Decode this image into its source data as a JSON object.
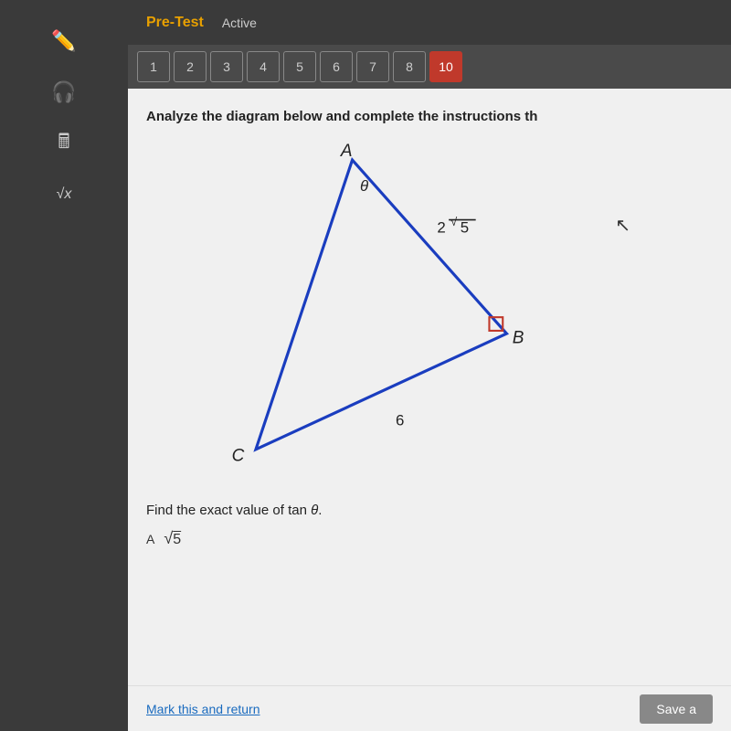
{
  "header": {
    "title": "Pre-Test",
    "status": "Active"
  },
  "question_bar": {
    "buttons": [
      "1",
      "2",
      "3",
      "4",
      "5",
      "6",
      "7",
      "8",
      "10"
    ],
    "active": "10"
  },
  "main": {
    "instruction": "Analyze the diagram below and complete the instructions th",
    "find_text": "Find the exact value of tan θ.",
    "diagram": {
      "vertex_a": "A",
      "vertex_b": "B",
      "vertex_c": "C",
      "angle_label": "θ",
      "side_ab": "2√5",
      "side_bc": "6"
    },
    "answer_options": [
      "A",
      "√5"
    ]
  },
  "footer": {
    "mark_return": "Mark this and return",
    "save_label": "Save a"
  },
  "sidebar": {
    "icons": [
      "pencil-icon",
      "headphone-icon",
      "calculator-icon",
      "formula-icon"
    ]
  }
}
